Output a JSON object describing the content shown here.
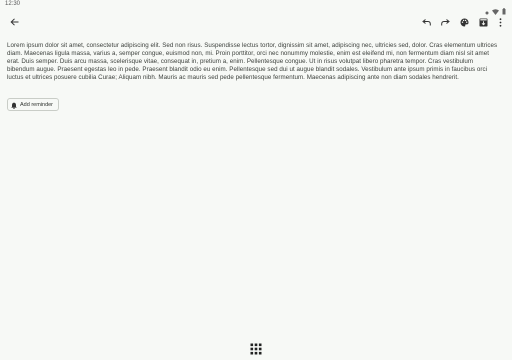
{
  "status_bar": {
    "time": "12:30"
  },
  "toolbar": {
    "back": "back-arrow-icon",
    "actions": [
      "undo-icon",
      "redo-icon",
      "palette-icon",
      "archive-icon",
      "more-vert-icon"
    ]
  },
  "note": {
    "body": "Lorem ipsum dolor sit amet, consectetur adipiscing elit. Sed non risus. Suspendisse lectus tortor, dignissim sit amet, adipiscing nec, ultricies sed, dolor. Cras elementum ultrices diam. Maecenas ligula massa, varius a, semper congue, euismod non, mi. Proin porttitor, orci nec nonummy molestie, enim est eleifend mi, non fermentum diam nisl sit amet erat. Duis semper. Duis arcu massa, scelerisque vitae, consequat in, pretium a, enim. Pellentesque congue. Ut in risus volutpat libero pharetra tempor. Cras vestibulum bibendum augue. Praesent egestas leo in pede. Praesent blandit odio eu enim. Pellentesque sed dui ut augue blandit sodales. Vestibulum ante ipsum primis in faucibus orci luctus et ultrices posuere cubilia Curae; Aliquam nibh. Mauris ac mauris sed pede pellentesque fermentum. Maecenas adipiscing ante non diam sodales hendrerit."
  },
  "reminder": {
    "label": "Add reminder",
    "icon": "bell-icon"
  },
  "bottom_bar": {
    "icon": "apps-grid-icon"
  }
}
